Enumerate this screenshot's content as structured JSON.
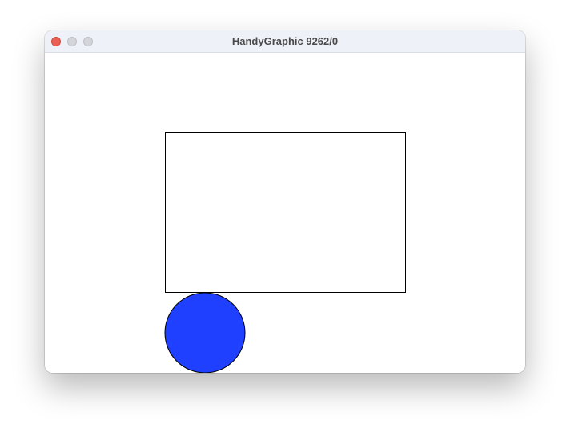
{
  "window": {
    "title": "HandyGraphic 9262/0"
  },
  "canvas": {
    "shapes": [
      {
        "type": "rectangle",
        "name": "drawn-rectangle",
        "fill": "#ffffff",
        "stroke": "#000000"
      },
      {
        "type": "circle",
        "name": "drawn-circle",
        "fill": "#2040ff",
        "stroke": "#000000"
      }
    ]
  },
  "colors": {
    "close_button": "#ec5f57",
    "inactive_button": "#d3d5da",
    "circle_fill": "#2040ff"
  }
}
